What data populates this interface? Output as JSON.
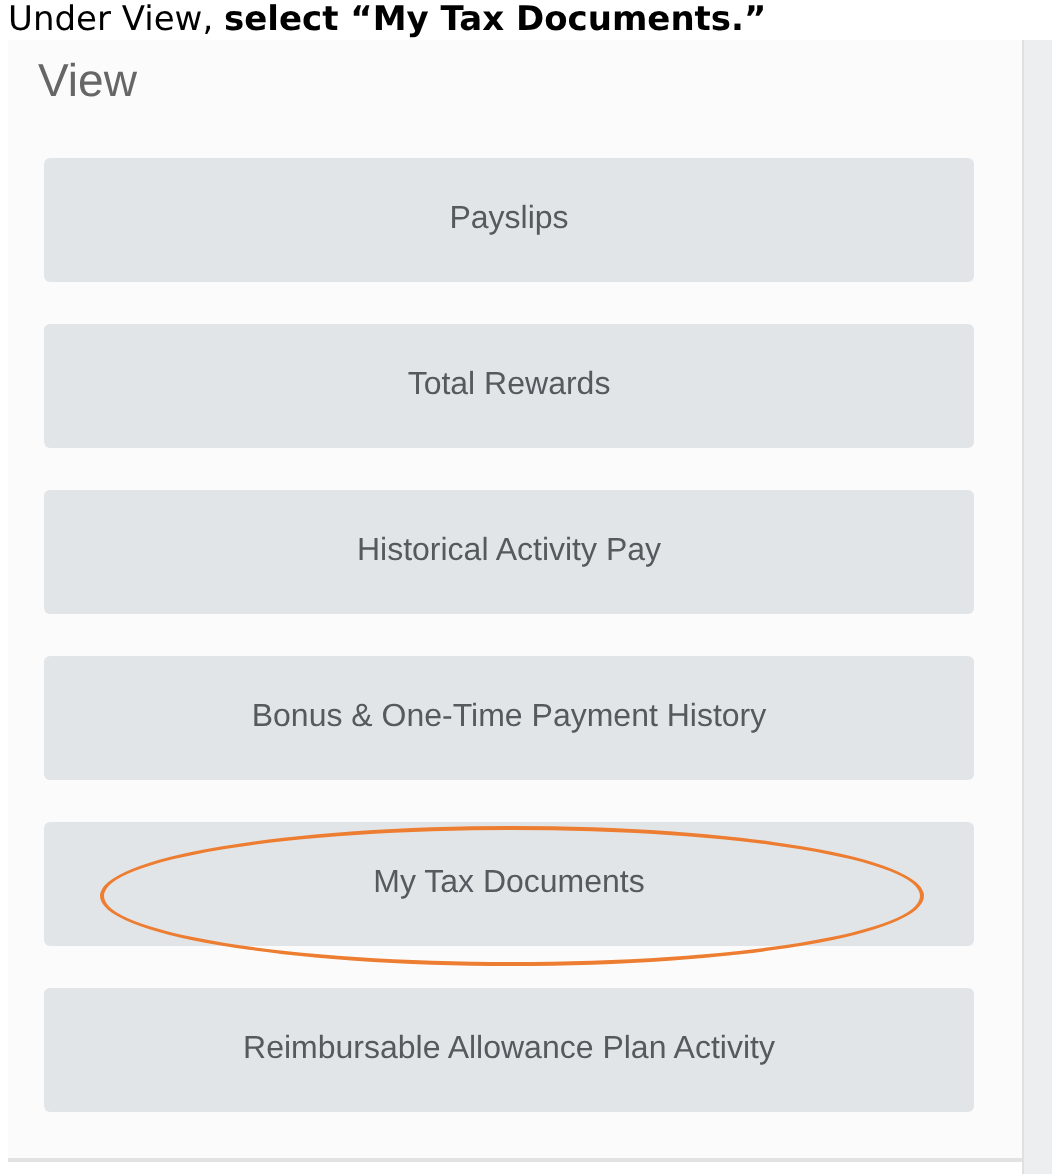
{
  "instruction": "Under View, **select “My Tax Documents.”**",
  "section": {
    "title": "View"
  },
  "buttons": [
    {
      "label": "Payslips",
      "circled": false
    },
    {
      "label": "Total Rewards",
      "circled": false
    },
    {
      "label": "Historical Activity Pay",
      "circled": false
    },
    {
      "label": "Bonus & One-Time Payment History",
      "circled": false
    },
    {
      "label": "My Tax Documents",
      "circled": true
    },
    {
      "label": "Reimbursable Allowance Plan Activity",
      "circled": false
    }
  ]
}
